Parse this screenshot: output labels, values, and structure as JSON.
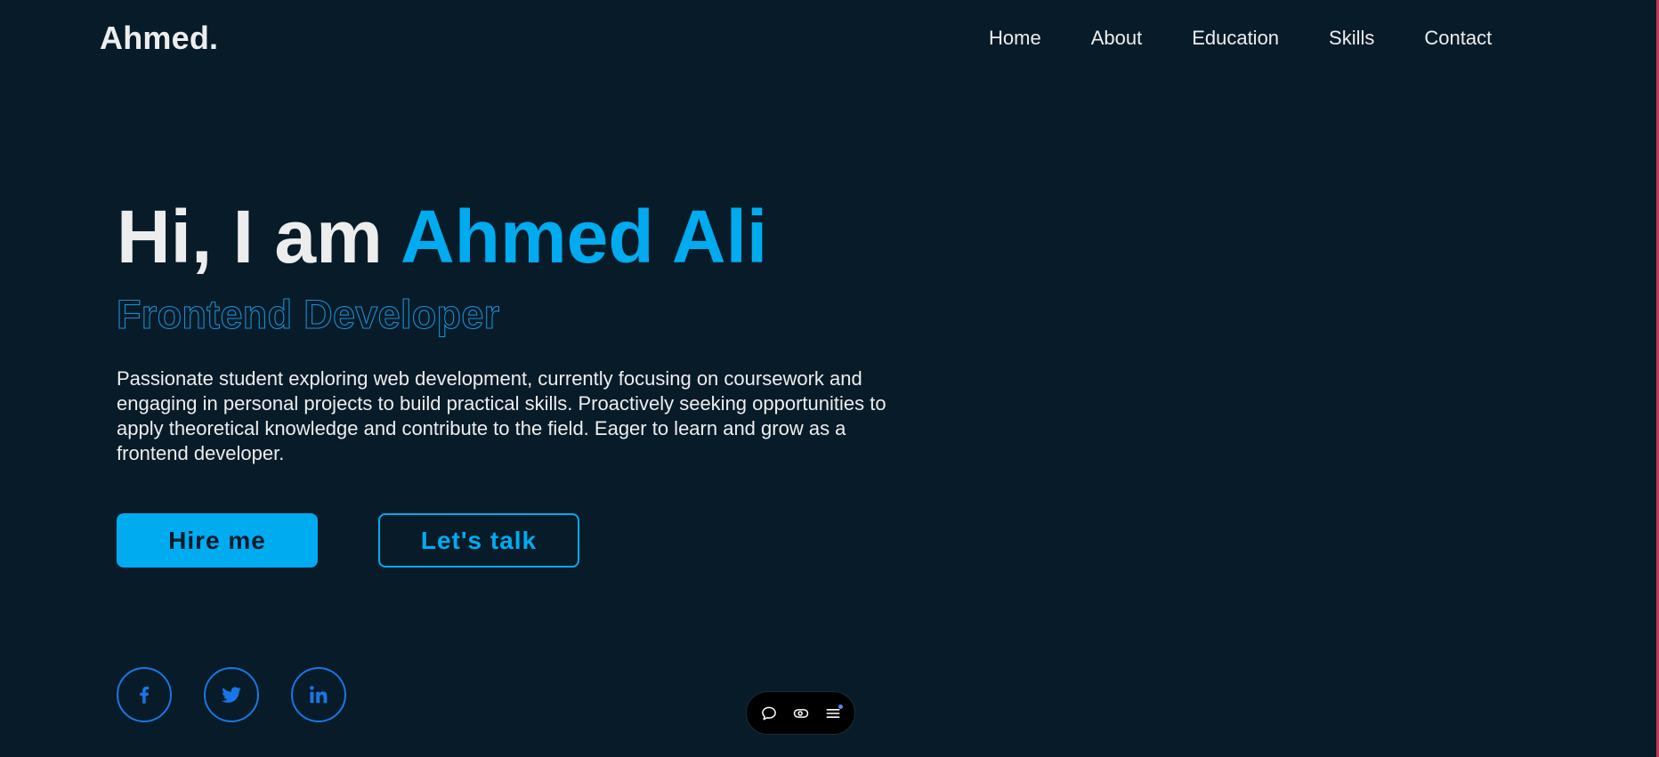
{
  "header": {
    "logo": "Ahmed.",
    "nav": [
      "Home",
      "About",
      "Education",
      "Skills",
      "Contact"
    ]
  },
  "hero": {
    "greeting": "Hi, I am",
    "name": "Ahmed Ali",
    "role": "Frontend Developer",
    "description": "Passionate student exploring web development, currently focusing on coursework and engaging in personal projects to build practical skills. Proactively seeking opportunities to apply theoretical knowledge and contribute to the field. Eager to learn and grow as a frontend developer."
  },
  "buttons": {
    "hire": "Hire me",
    "talk": "Let's talk"
  },
  "social": [
    "facebook-icon",
    "twitter-icon",
    "linkedin-icon"
  ],
  "toolbar": [
    "chat-bubble-icon",
    "toggle-icon",
    "menu-icon"
  ],
  "colors": {
    "background": "#081b29",
    "accent": "#00abf0",
    "text": "#ededed",
    "social_border": "#1877e8"
  }
}
